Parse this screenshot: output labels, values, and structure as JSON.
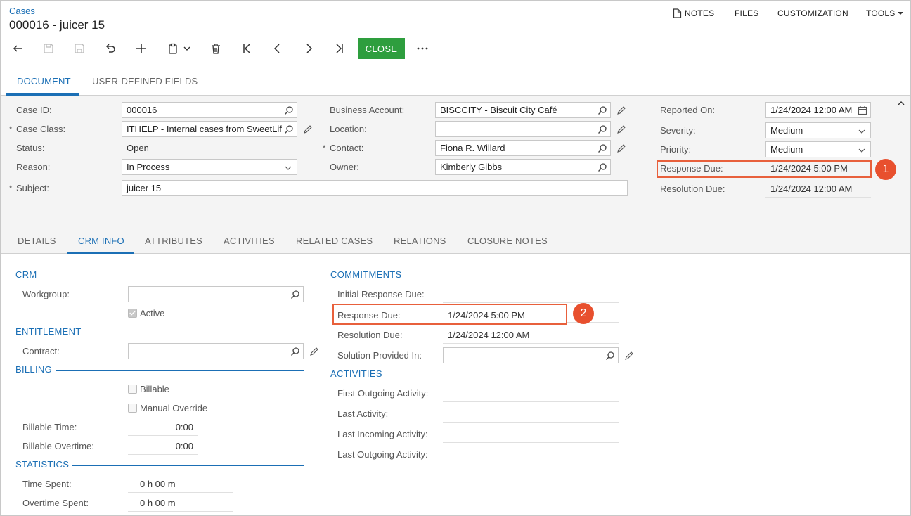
{
  "breadcrumb": "Cases",
  "page_title": "000016 - juicer 15",
  "top_menu": {
    "notes": "NOTES",
    "files": "FILES",
    "customization": "CUSTOMIZATION",
    "tools": "TOOLS"
  },
  "toolbar": {
    "close_label": "CLOSE"
  },
  "tabs": {
    "document": "DOCUMENT",
    "user_defined": "USER-DEFINED FIELDS"
  },
  "summary": {
    "case_id_label": "Case ID:",
    "case_id": "000016",
    "case_class_label": "Case Class:",
    "case_class": "ITHELP - Internal cases from SweetLif",
    "status_label": "Status:",
    "status": "Open",
    "reason_label": "Reason:",
    "reason": "In Process",
    "subject_label": "Subject:",
    "subject": "juicer 15",
    "business_account_label": "Business Account:",
    "business_account": "BISCCITY - Biscuit City Café",
    "location_label": "Location:",
    "location": "",
    "contact_label": "Contact:",
    "contact": "Fiona R. Willard",
    "owner_label": "Owner:",
    "owner": "Kimberly Gibbs",
    "reported_on_label": "Reported On:",
    "reported_on": "1/24/2024 12:00 AM",
    "severity_label": "Severity:",
    "severity": "Medium",
    "priority_label": "Priority:",
    "priority": "Medium",
    "response_due_label": "Response Due:",
    "response_due": "1/24/2024 5:00 PM",
    "resolution_due_label": "Resolution Due:",
    "resolution_due": "1/24/2024 12:00 AM",
    "required_mark": "*"
  },
  "subtabs": {
    "details": "DETAILS",
    "crm_info": "CRM INFO",
    "attributes": "ATTRIBUTES",
    "activities": "ACTIVITIES",
    "related_cases": "RELATED CASES",
    "relations": "RELATIONS",
    "closure_notes": "CLOSURE NOTES"
  },
  "crm": {
    "section": "CRM",
    "workgroup_label": "Workgroup:",
    "workgroup": "",
    "active_label": "Active"
  },
  "entitlement": {
    "section": "ENTITLEMENT",
    "contract_label": "Contract:",
    "contract": ""
  },
  "billing": {
    "section": "BILLING",
    "billable_label": "Billable",
    "manual_override_label": "Manual Override",
    "billable_time_label": "Billable Time:",
    "billable_time": "0:00",
    "billable_overtime_label": "Billable Overtime:",
    "billable_overtime": "0:00"
  },
  "statistics": {
    "section": "STATISTICS",
    "time_spent_label": "Time Spent:",
    "time_spent": "0 h 00 m",
    "overtime_spent_label": "Overtime Spent:",
    "overtime_spent": "0 h 00 m"
  },
  "commitments": {
    "section": "COMMITMENTS",
    "initial_response_due_label": "Initial Response Due:",
    "initial_response_due": "",
    "response_due_label": "Response Due:",
    "response_due": "1/24/2024 5:00 PM",
    "resolution_due_label": "Resolution Due:",
    "resolution_due": "1/24/2024 12:00 AM",
    "solution_provided_label": "Solution Provided In:",
    "solution_provided": ""
  },
  "activities": {
    "section": "ACTIVITIES",
    "first_outgoing_label": "First Outgoing Activity:",
    "last_activity_label": "Last Activity:",
    "last_incoming_label": "Last Incoming Activity:",
    "last_outgoing_label": "Last Outgoing Activity:"
  },
  "callouts": {
    "one": "1",
    "two": "2"
  },
  "colors": {
    "accent": "#1b6fb5",
    "close_button": "#2e9e3e",
    "callout": "#e8502e"
  }
}
